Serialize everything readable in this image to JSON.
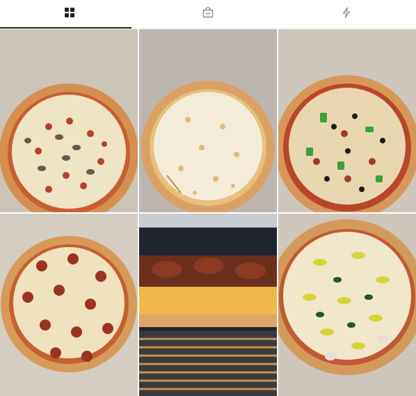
{
  "tabs": [
    {
      "icon": "grid-icon",
      "active": true
    },
    {
      "icon": "shopping-bag-icon",
      "active": false
    },
    {
      "icon": "lightning-icon",
      "active": false
    }
  ],
  "gallery": {
    "photos": [
      {
        "subject": "pizza-sausage-mushroom"
      },
      {
        "subject": "pizza-cheese"
      },
      {
        "subject": "pizza-supreme"
      },
      {
        "subject": "pizza-pepperoni"
      },
      {
        "subject": "pizza-slice-in-oven"
      },
      {
        "subject": "pizza-veggie-banana-peppers"
      }
    ]
  },
  "colors": {
    "tab_active": "#222222",
    "tab_inactive": "#8e8e8e",
    "box_cardboard": "#cfc6bb",
    "crust": "#d79a55",
    "sauce": "#b8472a",
    "cheese": "#f1e8cc"
  }
}
